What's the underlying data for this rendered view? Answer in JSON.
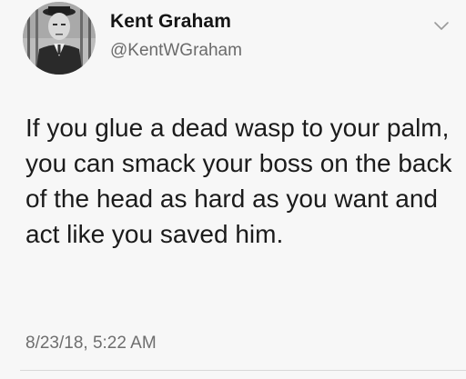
{
  "tweet": {
    "author_name": "Kent Graham",
    "handle": "@KentWGraham",
    "text": "If you glue a dead wasp to your palm, you can smack your boss on the back of the head as hard as you want and act like you saved him.",
    "timestamp": "8/23/18, 5:22 AM",
    "avatar_icon": "profile-photo",
    "menu_icon": "chevron-down-icon"
  }
}
